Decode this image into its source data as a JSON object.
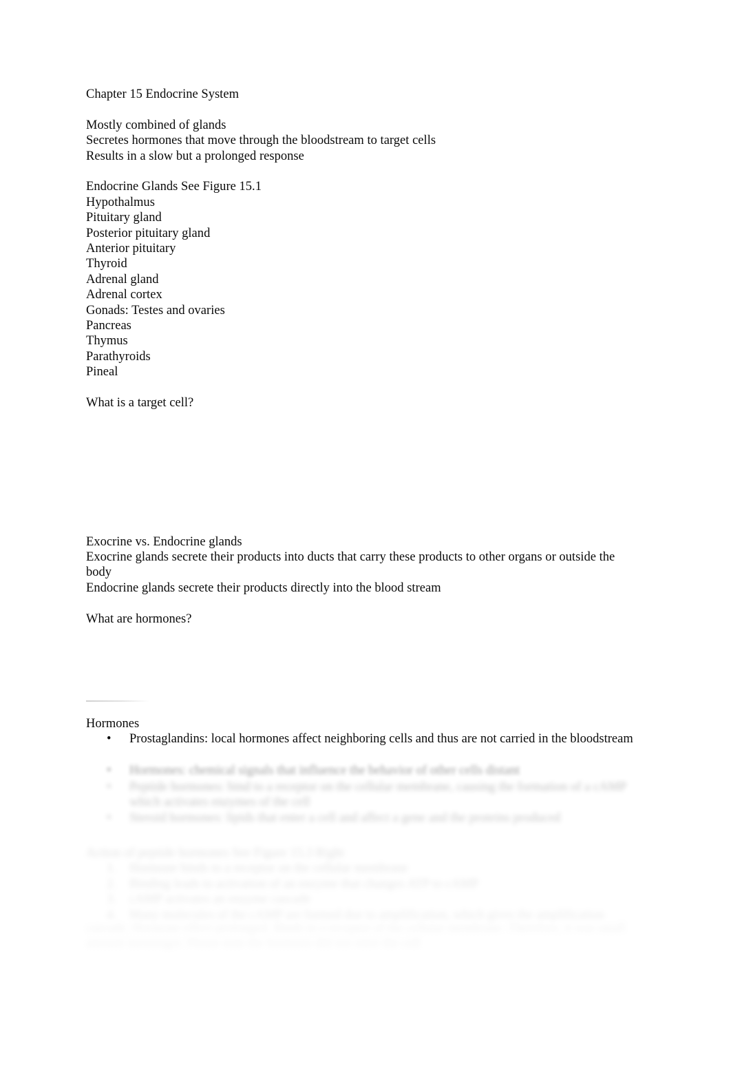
{
  "document": {
    "title": "Chapter 15 Endocrine System",
    "intro_lines": [
      "Mostly combined of glands",
      "Secretes hormones that move through the bloodstream to target cells",
      "Results in a slow but a prolonged response"
    ],
    "glands_heading": "Endocrine Glands See Figure 15.1",
    "glands": [
      "Hypothalmus",
      "Pituitary gland",
      "Posterior pituitary gland",
      "Anterior pituitary",
      "Thyroid",
      "Adrenal gland",
      "Adrenal cortex",
      "Gonads: Testes and ovaries",
      "Pancreas",
      "Thymus",
      "Parathyroids",
      "Pineal"
    ],
    "question_target_cell": "What is a target cell?",
    "exocrine_heading": "Exocrine vs. Endocrine glands",
    "exocrine_body": "Exocrine glands secrete their products into ducts that carry these products to other organs or outside the body",
    "endocrine_body": "Endocrine glands secrete their products directly into the blood stream",
    "question_hormones": "What are hormones?",
    "hormones_heading": "Hormones",
    "hormones_bullets": [
      {
        "marker": "•",
        "text": "Prostaglandins: local hormones affect neighboring cells and thus are not carried in the bloodstream"
      },
      {
        "marker": "•",
        "text": "Hormones: chemical signals that influence the behavior of other cells distant"
      },
      {
        "marker": "•",
        "text": "Peptide hormones: bind to a receptor on the cellular membrane, causing the formation of a cAMP which activates enzymes of the cell"
      },
      {
        "marker": "•",
        "text": "Steroid hormones: lipids that enter a cell and affect a gene and the proteins produced"
      }
    ],
    "steps_heading": "Action of peptide hormones See Figure 15.3 Right",
    "steps": [
      {
        "marker": "1.",
        "text": "Hormone binds to a receptor on the cellular membrane"
      },
      {
        "marker": "2.",
        "text": "Binding leads to activation of an enzyme that changes ATP to cAMP"
      },
      {
        "marker": "3.",
        "text": "cAMP activates an enzyme cascade"
      },
      {
        "marker": "4.",
        "text": "Many molecules of the cAMP are formed due to amplification, which gives the amplification"
      }
    ],
    "tail_paragraph": "cascade. Hormone effect prolonged. Binds to a receptor of the cellular membrane. Therefore, it was small amount messenger. Please note the hormone did not enter the cell"
  }
}
